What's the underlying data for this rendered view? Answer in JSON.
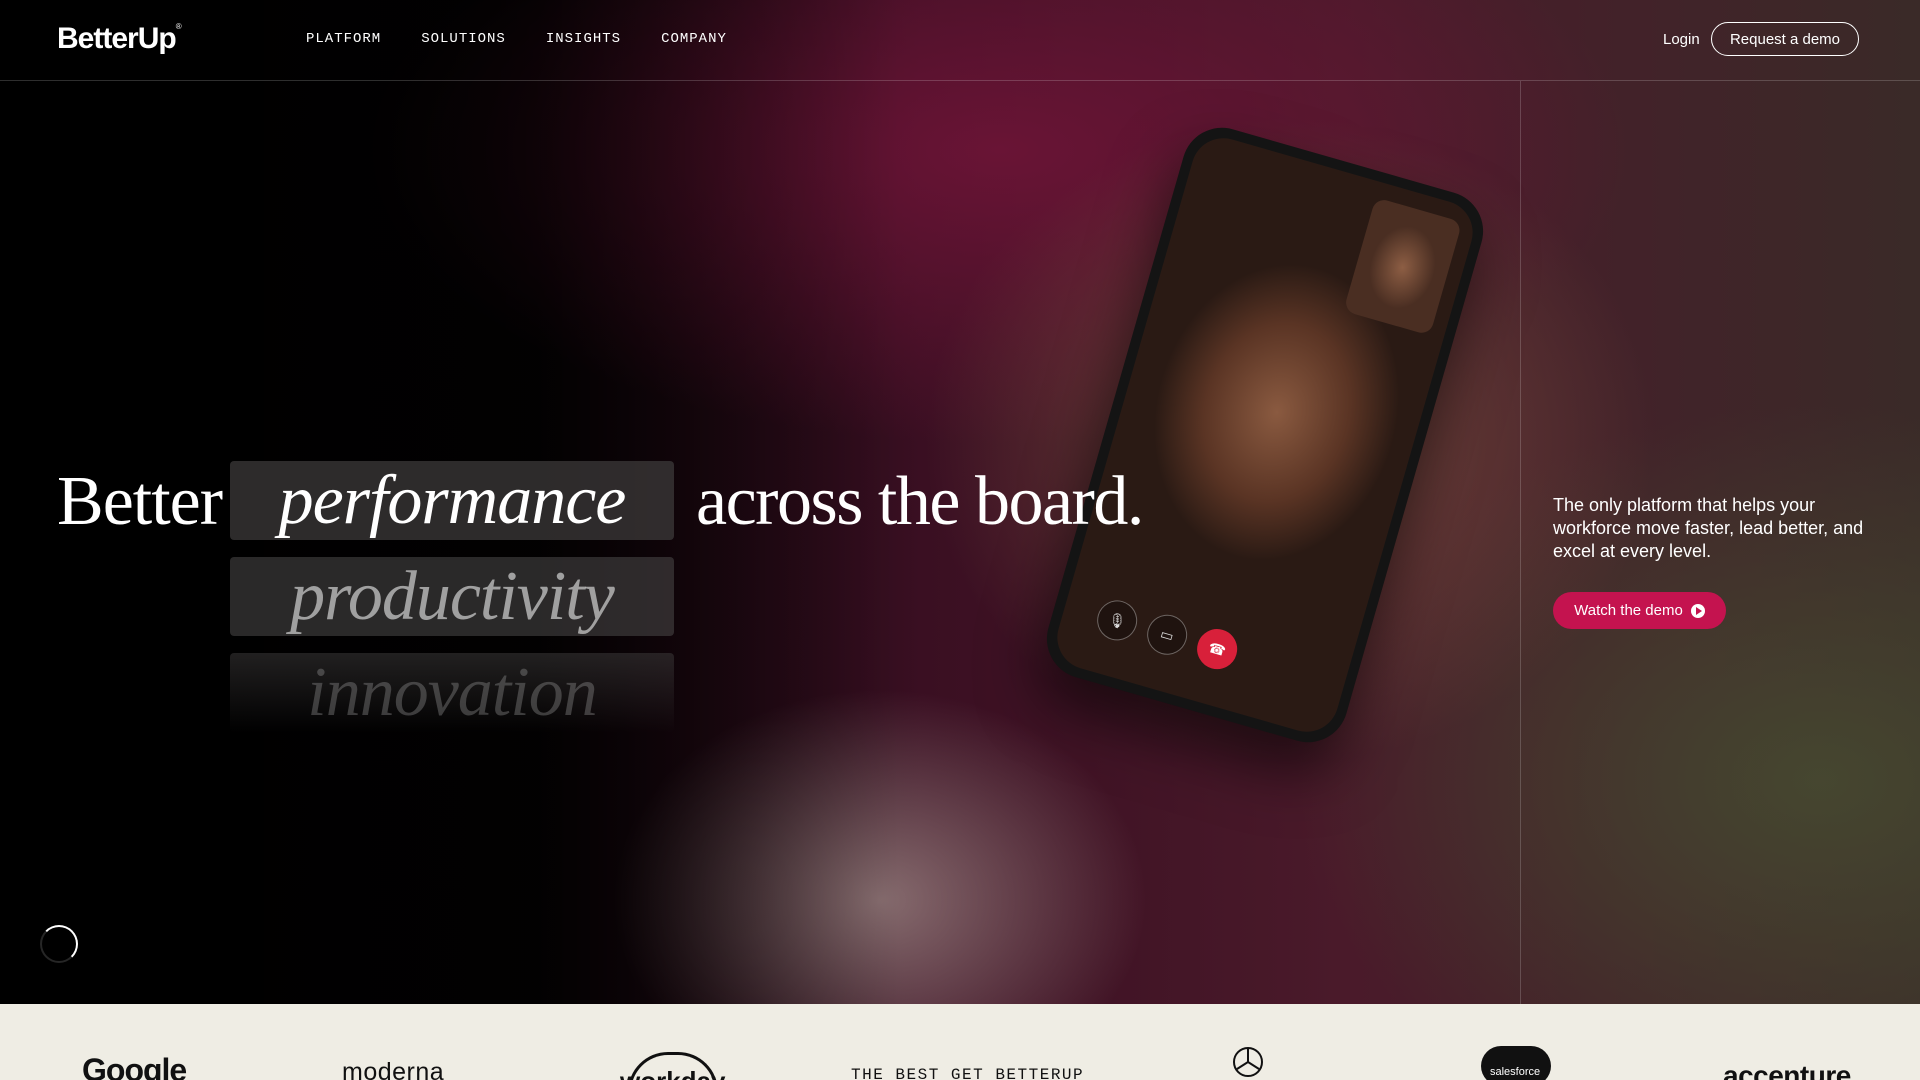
{
  "nav": {
    "logo": "BetterUp",
    "links": [
      "PLATFORM",
      "SOLUTIONS",
      "INSIGHTS",
      "COMPANY"
    ],
    "login": "Login",
    "request_demo": "Request a demo"
  },
  "hero": {
    "headline_prefix": "Better",
    "rotating_words": [
      "performance",
      "productivity",
      "innovation"
    ],
    "headline_suffix": "across the board.",
    "tagline": "The only platform that helps your workforce move faster, lead better, and excel at every level.",
    "watch_demo": "Watch the demo"
  },
  "logos": {
    "items": [
      "Google",
      "moderna",
      "workday",
      "THE BEST GET BETTERUP",
      "salesforce",
      "accenture"
    ]
  },
  "colors": {
    "accent": "#c4134f",
    "strip_bg": "#efede4"
  }
}
